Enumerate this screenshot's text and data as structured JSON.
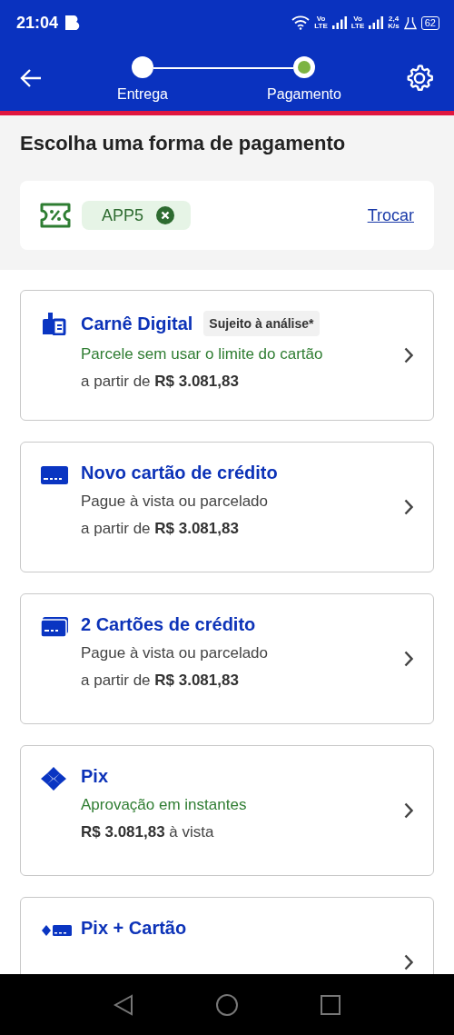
{
  "status_bar": {
    "time": "21:04",
    "sims": [
      {
        "top": "Vo",
        "bottom": "LTE"
      },
      {
        "top": "Vo",
        "bottom": "LTE"
      }
    ],
    "net_speed": {
      "value": "2,4",
      "unit": "K/s"
    },
    "battery": "62"
  },
  "header": {
    "steps": [
      {
        "label": "Entrega",
        "current": false
      },
      {
        "label": "Pagamento",
        "current": true
      }
    ]
  },
  "title": "Escolha uma forma de pagamento",
  "coupon": {
    "code": "APP5",
    "action": "Trocar"
  },
  "payment_options": [
    {
      "kind": "carne",
      "title": "Carnê Digital",
      "badge": "Sujeito à análise*",
      "subtitle": "Parcele sem usar o limite do cartão",
      "highlighted": true,
      "price": "a partir de **R$ 3.081,83**"
    },
    {
      "kind": "card",
      "title": "Novo cartão de crédito",
      "subtitle": "Pague à vista ou parcelado",
      "highlighted": false,
      "price": "a partir de **R$ 3.081,83**"
    },
    {
      "kind": "cards",
      "title": "2 Cartões de crédito",
      "subtitle": "Pague à vista ou parcelado",
      "highlighted": false,
      "price": "a partir de **R$ 3.081,83**"
    },
    {
      "kind": "pix",
      "title": "Pix",
      "subtitle": "Aprovação em instantes",
      "highlighted": true,
      "price": "**R$ 3.081,83** à vista"
    },
    {
      "kind": "pix_card",
      "title": "Pix + Cartão"
    }
  ]
}
